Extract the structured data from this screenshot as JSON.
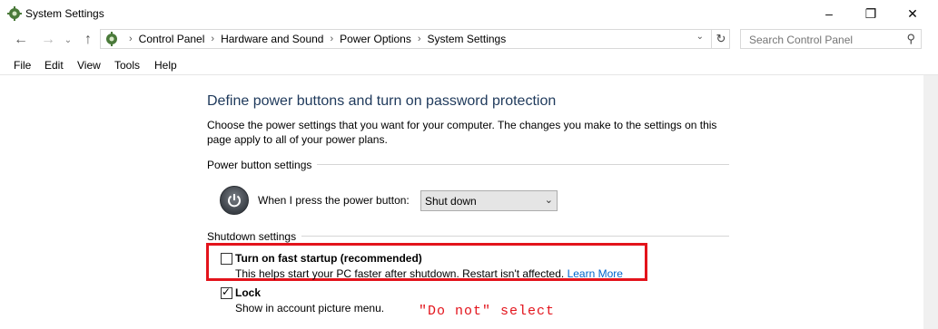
{
  "window": {
    "title": "System Settings",
    "min_icon": "minimize-icon",
    "max_icon": "restore-icon",
    "close_icon": "close-icon"
  },
  "nav": {
    "breadcrumbs": [
      "Control Panel",
      "Hardware and Sound",
      "Power Options",
      "System Settings"
    ],
    "search_placeholder": "Search Control Panel"
  },
  "menu": {
    "items": [
      "File",
      "Edit",
      "View",
      "Tools",
      "Help"
    ]
  },
  "page": {
    "heading": "Define power buttons and turn on password protection",
    "description": "Choose the power settings that you want for your computer. The changes you make to the settings on this page apply to all of your power plans.",
    "power_group": "Power button settings",
    "power_label": "When I press the power button:",
    "power_value": "Shut down",
    "shutdown_group": "Shutdown settings",
    "fast_startup": {
      "title": "Turn on fast startup (recommended)",
      "desc": "This helps start your PC faster after shutdown. Restart isn't affected.",
      "link": "Learn More",
      "checked": false
    },
    "lock": {
      "title": "Lock",
      "desc": "Show in account picture menu.",
      "checked": true
    }
  },
  "annotation": {
    "note": "\"Do not\" select",
    "color": "#e3131b"
  }
}
